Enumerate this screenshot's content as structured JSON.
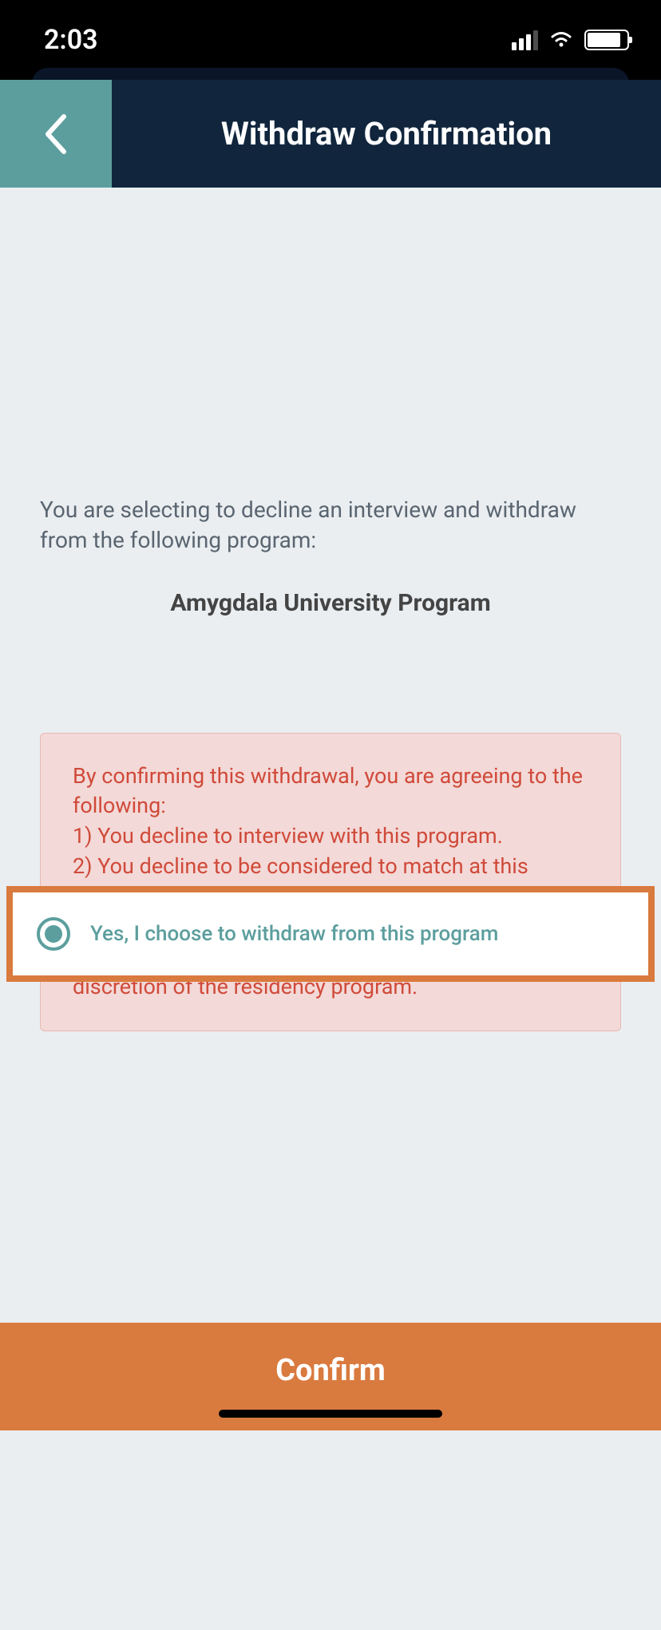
{
  "statusBar": {
    "time": "2:03"
  },
  "header": {
    "title": "Withdraw Confirmation"
  },
  "content": {
    "introText": "You are selecting to decline an interview and withdraw from the following program:",
    "programName": "Amygdala University Program",
    "radioLabel": "Yes, I choose to withdraw from this program",
    "warningText": "By confirming this withdrawal, you are agreeing to the following:\n1) You decline to interview with this program.\n2) You decline to be considered to match at this program.\n3) If you choose to withdraw and then change your mind, you agree to be reinstated only at the sole discretion of the residency program."
  },
  "footer": {
    "confirmLabel": "Confirm"
  }
}
